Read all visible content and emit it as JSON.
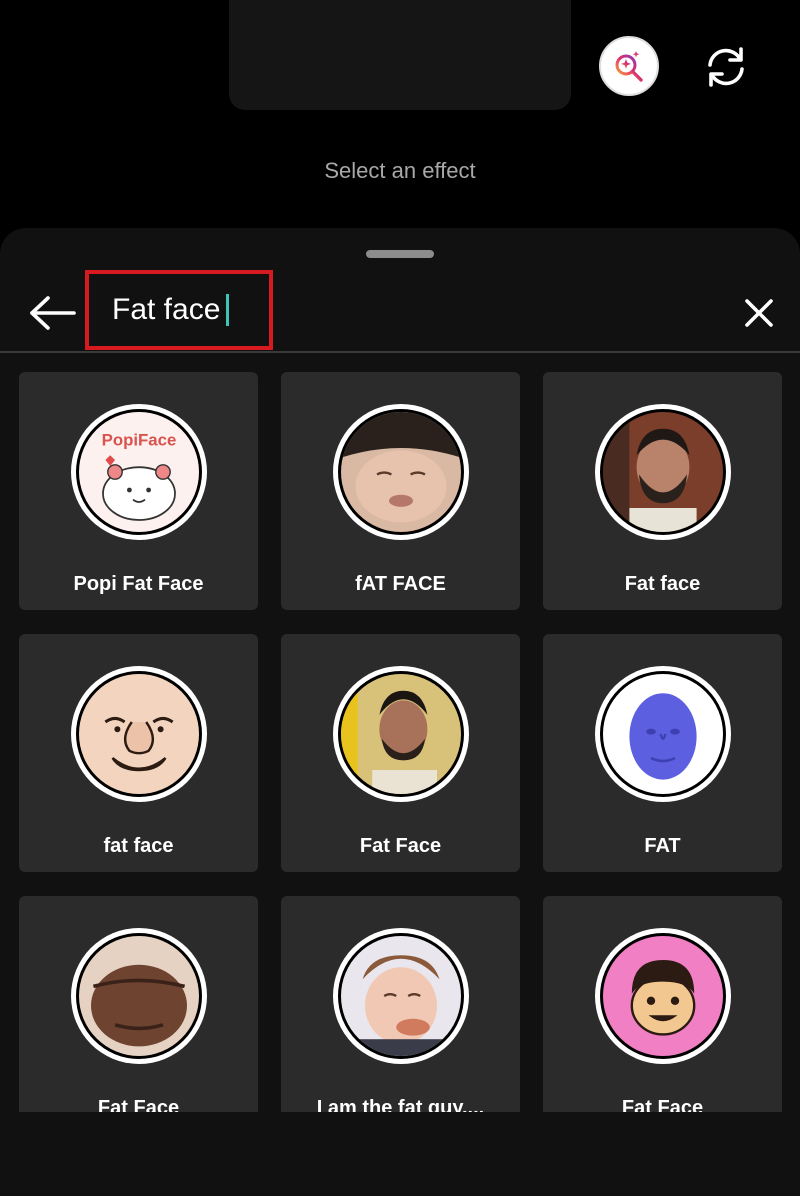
{
  "top_bar": {
    "search_effects_icon": "search-sparkle-icon",
    "flip_camera_icon": "flip-camera-icon"
  },
  "prompt": "Select an effect",
  "search": {
    "value": "Fat face",
    "back_icon": "arrow-left-icon",
    "clear_icon": "close-icon",
    "highlight_color": "#d71920",
    "caret_color": "#3fc4b8"
  },
  "effects": [
    {
      "label": "Popi Fat Face",
      "icon": "popi-cartoon-bear-icon"
    },
    {
      "label": "fAT FACE",
      "icon": "squished-face-photo"
    },
    {
      "label": "Fat face",
      "icon": "bearded-man-photo"
    },
    {
      "label": "fat face",
      "icon": "cartoon-face-icon"
    },
    {
      "label": "Fat Face",
      "icon": "man-photo"
    },
    {
      "label": "FAT",
      "icon": "blue-3d-face-icon"
    },
    {
      "label": "Fat Face",
      "icon": "distorted-face-photo"
    },
    {
      "label": "I am the fat guy....",
      "icon": "puffy-cheek-photo"
    },
    {
      "label": "Fat Face",
      "icon": "cartoon-boy-pink-icon"
    }
  ]
}
